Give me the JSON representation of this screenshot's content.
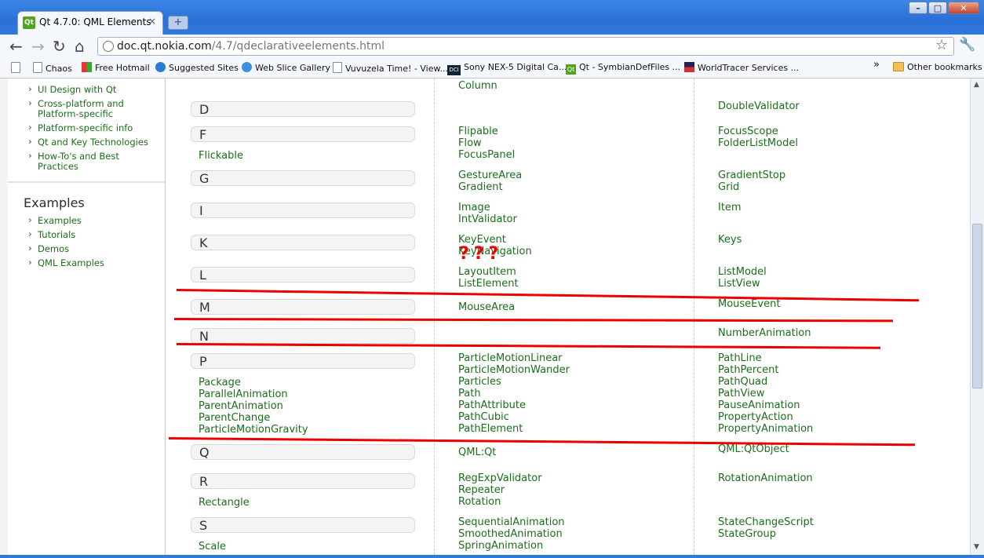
{
  "tab": {
    "title": "Qt 4.7.0: QML Elements",
    "close": "×",
    "favicon": "Qt"
  },
  "newtab_label": "+",
  "window_buttons": [
    "–",
    "□",
    "✕"
  ],
  "nav": {
    "back": "←",
    "forward": "→",
    "reload": "↻",
    "home": "⌂"
  },
  "address": {
    "host": "doc.qt.nokia.com",
    "path": "/4.7/qdeclarativeelements.html"
  },
  "bookmarks": [
    "Chaos",
    "Free Hotmail",
    "Suggested Sites",
    "Web Slice Gallery",
    "Vuvuzela Time! - View...",
    "Sony NEX-5 Digital Ca...",
    "Qt - SymbianDefFiles ...",
    "WorldTracer Services ..."
  ],
  "bookmarks_overflow": "»",
  "other_bookmarks": "Other bookmarks",
  "sidebar": {
    "guides": [
      "UI Design with Qt",
      "Cross-platform and",
      "Platform-specific",
      "Platform-specific info",
      "Qt and Key Technologies",
      "How-To's and Best",
      "Practices"
    ],
    "examples_title": "Examples",
    "examples": [
      "Examples",
      "Tutorials",
      "Demos",
      "QML Examples"
    ]
  },
  "letters": [
    "D",
    "F",
    "G",
    "I",
    "K",
    "L",
    "M",
    "N",
    "P",
    "Q",
    "R",
    "S"
  ],
  "col1_items": [
    "Flickable",
    "Package",
    "ParallelAnimation",
    "ParentAnimation",
    "ParentChange",
    "ParticleMotionGravity",
    "Rectangle",
    "Scale"
  ],
  "col2_items": [
    "Column",
    "Flipable",
    "Flow",
    "FocusPanel",
    "GestureArea",
    "Gradient",
    "Image",
    "IntValidator",
    "KeyEvent",
    "KeyNavigation",
    "LayoutItem",
    "ListElement",
    "MouseArea",
    "ParticleMotionLinear",
    "ParticleMotionWander",
    "Particles",
    "Path",
    "PathAttribute",
    "PathCubic",
    "PathElement",
    "QML:Qt",
    "RegExpValidator",
    "Repeater",
    "Rotation",
    "SequentialAnimation",
    "SmoothedAnimation",
    "SpringAnimation"
  ],
  "col3_items": [
    "DoubleValidator",
    "FocusScope",
    "FolderListModel",
    "GradientStop",
    "Grid",
    "Item",
    "Keys",
    "ListModel",
    "ListView",
    "MouseEvent",
    "NumberAnimation",
    "PathLine",
    "PathPercent",
    "PathQuad",
    "PathView",
    "PauseAnimation",
    "PropertyAction",
    "PropertyAnimation",
    "QML:QtObject",
    "RotationAnimation",
    "StateChangeScript",
    "StateGroup"
  ],
  "annotation": "???",
  "colors": {
    "link": "#1b6e1b",
    "annotation": "#e00000",
    "titlebar": "#2f79df"
  }
}
